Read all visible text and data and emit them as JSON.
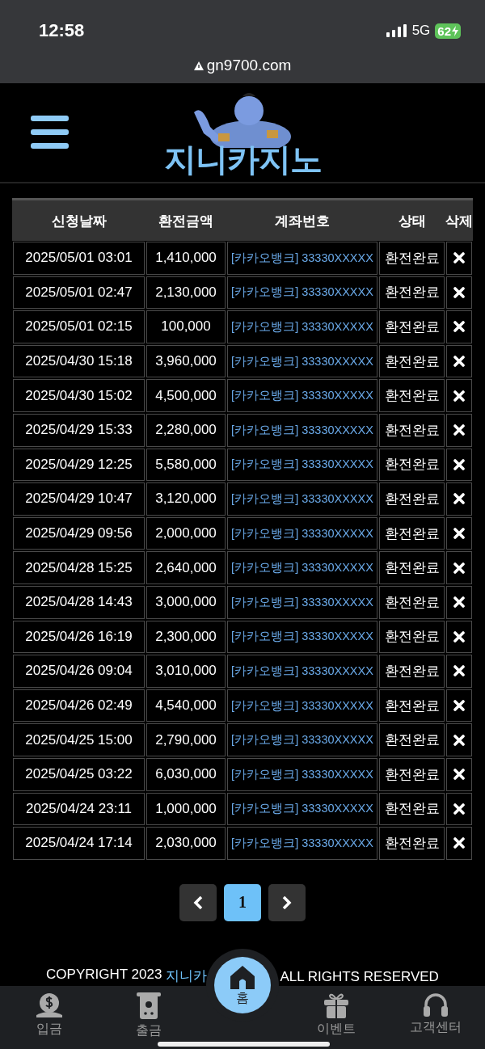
{
  "status_bar": {
    "time": "12:58",
    "network": "5G",
    "battery": "62"
  },
  "address_bar": {
    "url": "gn9700.com"
  },
  "header": {
    "logo_text": "지니카지노"
  },
  "table": {
    "columns": [
      "신청날짜",
      "환전금액",
      "계좌번호",
      "상태",
      "삭제"
    ],
    "rows": [
      {
        "date": "2025/05/01 03:01",
        "amount": "1,410,000",
        "account": "[카카오뱅크] 33330XXXXX",
        "status": "환전완료"
      },
      {
        "date": "2025/05/01 02:47",
        "amount": "2,130,000",
        "account": "[카카오뱅크] 33330XXXXX",
        "status": "환전완료"
      },
      {
        "date": "2025/05/01 02:15",
        "amount": "100,000",
        "account": "[카카오뱅크] 33330XXXXX",
        "status": "환전완료"
      },
      {
        "date": "2025/04/30 15:18",
        "amount": "3,960,000",
        "account": "[카카오뱅크] 33330XXXXX",
        "status": "환전완료"
      },
      {
        "date": "2025/04/30 15:02",
        "amount": "4,500,000",
        "account": "[카카오뱅크] 33330XXXXX",
        "status": "환전완료"
      },
      {
        "date": "2025/04/29 15:33",
        "amount": "2,280,000",
        "account": "[카카오뱅크] 33330XXXXX",
        "status": "환전완료"
      },
      {
        "date": "2025/04/29 12:25",
        "amount": "5,580,000",
        "account": "[카카오뱅크] 33330XXXXX",
        "status": "환전완료"
      },
      {
        "date": "2025/04/29 10:47",
        "amount": "3,120,000",
        "account": "[카카오뱅크] 33330XXXXX",
        "status": "환전완료"
      },
      {
        "date": "2025/04/29 09:56",
        "amount": "2,000,000",
        "account": "[카카오뱅크] 33330XXXXX",
        "status": "환전완료"
      },
      {
        "date": "2025/04/28 15:25",
        "amount": "2,640,000",
        "account": "[카카오뱅크] 33330XXXXX",
        "status": "환전완료"
      },
      {
        "date": "2025/04/28 14:43",
        "amount": "3,000,000",
        "account": "[카카오뱅크] 33330XXXXX",
        "status": "환전완료"
      },
      {
        "date": "2025/04/26 16:19",
        "amount": "2,300,000",
        "account": "[카카오뱅크] 33330XXXXX",
        "status": "환전완료"
      },
      {
        "date": "2025/04/26 09:04",
        "amount": "3,010,000",
        "account": "[카카오뱅크] 33330XXXXX",
        "status": "환전완료"
      },
      {
        "date": "2025/04/26 02:49",
        "amount": "4,540,000",
        "account": "[카카오뱅크] 33330XXXXX",
        "status": "환전완료"
      },
      {
        "date": "2025/04/25 15:00",
        "amount": "2,790,000",
        "account": "[카카오뱅크] 33330XXXXX",
        "status": "환전완료"
      },
      {
        "date": "2025/04/25 03:22",
        "amount": "6,030,000",
        "account": "[카카오뱅크] 33330XXXXX",
        "status": "환전완료"
      },
      {
        "date": "2025/04/24 23:11",
        "amount": "1,000,000",
        "account": "[카카오뱅크] 33330XXXXX",
        "status": "환전완료"
      },
      {
        "date": "2025/04/24 17:14",
        "amount": "2,030,000",
        "account": "[카카오뱅크] 33330XXXXX",
        "status": "환전완료"
      }
    ]
  },
  "pagination": {
    "pages": [
      {
        "label": "1",
        "selected": true
      }
    ]
  },
  "footer": {
    "copyright_prefix": "COPYRIGHT 2023",
    "brand": "지니카",
    "copyright_suffix": "ALL RIGHTS RESERVED"
  },
  "bottom_nav": [
    {
      "kind": "deposit",
      "label": "입금",
      "selected": false
    },
    {
      "kind": "withdraw",
      "label": "출금",
      "selected": false
    },
    {
      "kind": "home",
      "label": "홈",
      "selected": true
    },
    {
      "kind": "event",
      "label": "이벤트",
      "selected": false
    },
    {
      "kind": "support",
      "label": "고객센터",
      "selected": false
    }
  ]
}
